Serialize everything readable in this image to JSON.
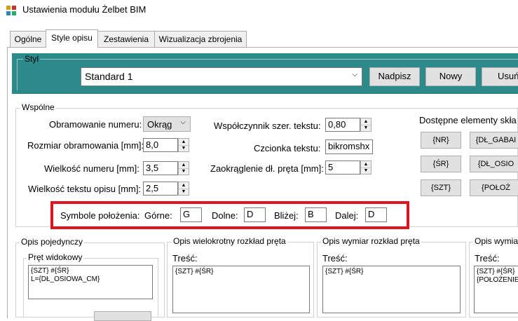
{
  "window": {
    "title": "Ustawienia modułu Żelbet BIM",
    "app_icon": "app-grid-icon"
  },
  "tabs": [
    {
      "label": "Ogólne"
    },
    {
      "label": "Style opisu"
    },
    {
      "label": "Zestawienia"
    },
    {
      "label": "Wizualizacja zbrojenia"
    }
  ],
  "styl": {
    "legend": "Styl",
    "selected": "Standard 1",
    "buttons": {
      "nadpisz": "Nadpisz",
      "nowy": "Nowy",
      "usun": "Usuń"
    },
    "panel_color": "#2d8a8a"
  },
  "wspolne": {
    "legend": "Wspólne",
    "obramowanie_label": "Obramowanie numeru:",
    "obramowanie_value": "Okrąg",
    "rozmiar_label": "Rozmiar obramowania [mm]:",
    "rozmiar_value": "8,0",
    "wielkosc_numeru_label": "Wielkość numeru [mm]:",
    "wielkosc_numeru_value": "3,5",
    "wielkosc_tekstu_label": "Wielkość tekstu opisu [mm]:",
    "wielkosc_tekstu_value": "2,5",
    "wspolczynnik_label": "Współczynnik szer. tekstu:",
    "wspolczynnik_value": "0,80",
    "czcionka_label": "Czcionka tekstu:",
    "czcionka_value": "bikromshx",
    "zaokraglenie_label": "Zaokrąglenie dł. pręta [mm]:",
    "zaokraglenie_value": "5",
    "dostepne_label": "Dostępne elementy skła",
    "elements": [
      "{NR}",
      "{DŁ_GABAI",
      "{ŚR}",
      "{DŁ_OSIO",
      "{SZT}",
      "{POŁOŻ"
    ]
  },
  "symbole": {
    "label": "Symbole położenia:",
    "gorne_label": "Górne:",
    "gorne_value": "G",
    "dolne_label": "Dolne:",
    "dolne_value": "D",
    "blizej_label": "Bliżej:",
    "blizej_value": "B",
    "dalej_label": "Dalej:",
    "dalej_value": "D",
    "highlight_color": "#e0141c"
  },
  "opis_pojedynczy": {
    "legend": "Opis pojedynczy",
    "pret_legend": "Pręt widokowy",
    "text": "{SZT} #{ŚR}\nL={DŁ_OSIOWA_CM}"
  },
  "opis_wielokrotny": {
    "legend": "Opis wielokrotny rozkład pręta",
    "tresc_label": "Treść:",
    "text": "{SZT} #{ŚR}"
  },
  "opis_wymiar": {
    "legend": "Opis wymiar rozkład pręta",
    "tresc_label": "Treść:",
    "text": "{SZT} #{ŚR}"
  },
  "opis_wymiar2": {
    "legend": "Opis wymiar",
    "tresc_label": "Treść:",
    "text": "{SZT} #{ŚR}\n{POŁOŻENIE"
  }
}
